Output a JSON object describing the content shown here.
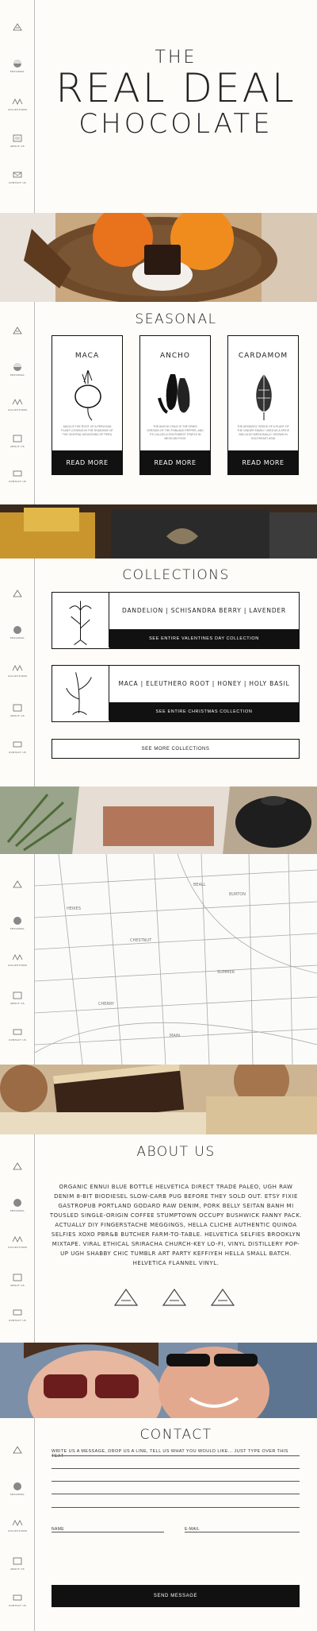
{
  "hero": {
    "line1": "THE",
    "line2": "REAL DEAL",
    "line3": "CHOCOLATE"
  },
  "nav": {
    "items": [
      {
        "icon": "home-logo-icon",
        "label": ""
      },
      {
        "icon": "seasonal-icon",
        "label": "SEASONAL"
      },
      {
        "icon": "collections-icon",
        "label": "COLLECTIONS"
      },
      {
        "icon": "about-icon",
        "label": "ABOUT US"
      },
      {
        "icon": "contact-icon",
        "label": "CONTACT US"
      }
    ]
  },
  "seasonal": {
    "title": "SEASONAL",
    "cards": [
      {
        "name": "MACA",
        "desc": "MACA IS THE ROOT OF A PERUVIAN PLANT LOOKING IN THE SHADOWS OF THE CENTRAL MOUNTAINS OF PERU",
        "button": "READ MORE",
        "art": "maca-root-icon"
      },
      {
        "name": "ANCHO",
        "desc": "THE ANCHO CHILE IS THE DRIED VERSION OF THE POBLANO PEPPER, AND ITS CALLED A SOUTHWEST STAPLE IN MEXICAN FOOD",
        "button": "READ MORE",
        "art": "ancho-pepper-icon"
      },
      {
        "name": "CARDAMOM",
        "desc": "THE AROMATIC SEEDS OF A PLANT OF THE GINGER FAMILY. USED AS A SPICE AND ALSO MEDICINALLY. GROWN IN SOUTHEAST ASIA",
        "button": "READ MORE",
        "art": "cardamom-pod-icon"
      }
    ]
  },
  "collections": {
    "title": "COLLECTIONS",
    "items": [
      {
        "names": "DANDELION | SCHISANDRA BERRY | LAVENDER",
        "link": "SEE ENTIRE VALENTINES DAY COLLECTION",
        "thumb": "dandelion-sketch-icon"
      },
      {
        "names": "MACA | ELEUTHERO ROOT | HONEY | HOLY BASIL",
        "link": "SEE ENTIRE CHRISTMAS COLLECTION",
        "thumb": "herb-sketch-icon"
      }
    ],
    "more": "SEE MORE COLLECTIONS"
  },
  "about": {
    "title": "ABOUT US",
    "text": "ORGANIC ENNUI BLUE BOTTLE HELVETICA DIRECT TRADE PALEO, UGH RAW DENIM 8-BIT BIODIESEL SLOW-CARB PUG BEFORE THEY SOLD OUT. ETSY FIXIE GASTROPUB PORTLAND GODARD RAW DENIM, PORK BELLY SEITAN BANH MI TOUSLED SINGLE-ORIGIN COFFEE STUMPTOWN OCCUPY BUSHWICK FANNY PACK. ACTUALLY DIY FINGERSTACHE MEGGINGS, HELLA CLICHE AUTHENTIC QUINOA SELFIES XOXO PBR&B BUTCHER FARM-TO-TABLE. HELVETICA SELFIES BROOKLYN MIXTAPE. VIRAL ETHICAL SRIRACHA CHURCH-KEY LO-FI, VINYL DISTILLERY POP-UP UGH SHABBY CHIC TUMBLR ART PARTY KEFFIYEH HELLA SMALL BATCH. HELVETICA FLANNEL VINYL."
  },
  "map": {
    "labels": [
      "BEALL",
      "BURTON",
      "HEIKES",
      "CHESTNUT",
      "SUMMER",
      "CHERRY",
      "MAIN"
    ]
  },
  "contact": {
    "title": "CONTACT",
    "message_placeholder": "WRITE US A MESSAGE, DROP US A LINE, TELL US WHAT YOU WOULD LIKE... JUST TYPE OVER THIS TEXT",
    "name_label": "NAME",
    "email_label": "E-MAIL",
    "send": "SEND MESSAGE"
  },
  "colors": {
    "ink": "#111111",
    "paper": "#fdfcf9",
    "rule": "#bbbbbb"
  }
}
